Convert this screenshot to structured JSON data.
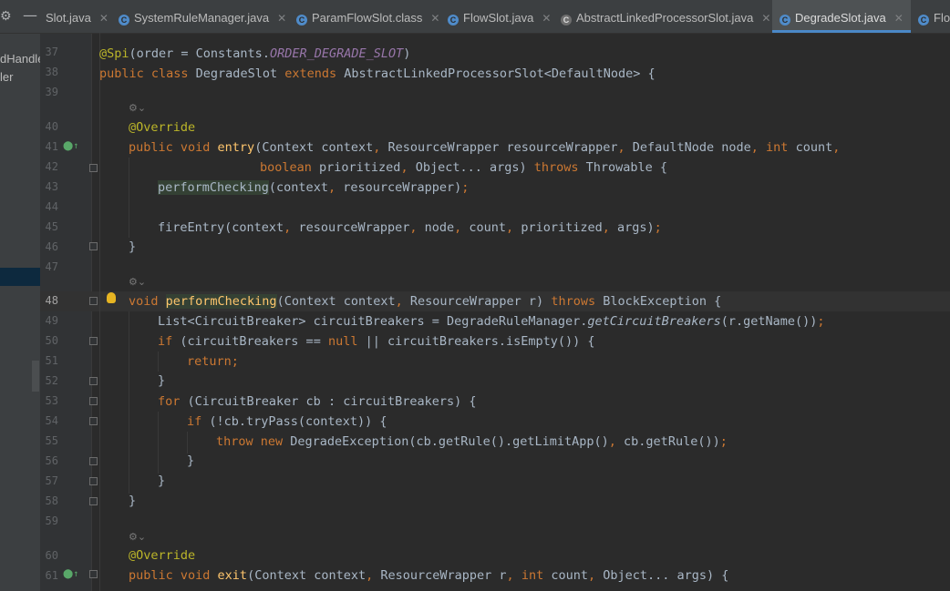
{
  "tabs": [
    {
      "label": "Slot.java",
      "icon": "",
      "active": false
    },
    {
      "label": "SystemRuleManager.java",
      "icon": "class-icon",
      "active": false
    },
    {
      "label": "ParamFlowSlot.class",
      "icon": "class-icon",
      "active": false
    },
    {
      "label": "FlowSlot.java",
      "icon": "class-icon",
      "active": false
    },
    {
      "label": "AbstractLinkedProcessorSlot.java",
      "icon": "abstract-class-icon",
      "active": false
    },
    {
      "label": "DegradeSlot.java",
      "icon": "class-icon",
      "active": true
    },
    {
      "label": "Flo",
      "icon": "class-icon",
      "active": false
    }
  ],
  "left_panel": {
    "items": [
      "dHandle",
      "ler"
    ]
  },
  "line_numbers": [
    "37",
    "38",
    "39",
    "40",
    "41",
    "42",
    "43",
    "44",
    "45",
    "46",
    "47",
    "48",
    "49",
    "50",
    "51",
    "52",
    "53",
    "54",
    "55",
    "56",
    "57",
    "58",
    "59",
    "60",
    "61"
  ],
  "code": {
    "l37_a": "@Spi",
    "l37_b": "(order = Constants.",
    "l37_c": "ORDER_DEGRADE_SLOT",
    "l37_d": ")",
    "l38_a": "public class ",
    "l38_b": "DegradeSlot ",
    "l38_c": "extends ",
    "l38_d": "AbstractLinkedProcessorSlot<DefaultNode> {",
    "l40": "@Override",
    "l41_a": "public void ",
    "l41_b": "entry",
    "l41_c": "(Context context",
    "l41_d": ", ",
    "l41_e": "ResourceWrapper resourceWrapper",
    "l41_f": ", ",
    "l41_g": "DefaultNode node",
    "l41_h": ", ",
    "l41_i": "int ",
    "l41_j": "count",
    "l41_k": ",",
    "l42_a": "boolean ",
    "l42_b": "prioritized",
    "l42_c": ", ",
    "l42_d": "Object... args) ",
    "l42_e": "throws ",
    "l42_f": "Throwable {",
    "l43_a": "performChecking",
    "l43_b": "(context",
    "l43_c": ", ",
    "l43_d": "resourceWrapper)",
    "l43_e": ";",
    "l45_a": "fireEntry(context",
    "l45_b": ", ",
    "l45_c": "resourceWrapper",
    "l45_d": ", ",
    "l45_e": "node",
    "l45_f": ", ",
    "l45_g": "count",
    "l45_h": ", ",
    "l45_i": "prioritized",
    "l45_j": ", ",
    "l45_k": "args)",
    "l45_l": ";",
    "l46": "}",
    "l48_a": "void ",
    "l48_b": "performChecking",
    "l48_c": "(Context context",
    "l48_d": ", ",
    "l48_e": "ResourceWrapper r) ",
    "l48_f": "throws ",
    "l48_g": "BlockException {",
    "l49_a": "List<CircuitBreaker> circuitBreakers = DegradeRuleManager.",
    "l49_b": "getCircuitBreakers",
    "l49_c": "(r.getName())",
    "l49_d": ";",
    "l50_a": "if ",
    "l50_b": "(circuitBreakers == ",
    "l50_c": "null ",
    "l50_d": "|| circuitBreakers.isEmpty()) {",
    "l51": "return;",
    "l52": "}",
    "l53_a": "for ",
    "l53_b": "(CircuitBreaker cb : circuitBreakers) {",
    "l54_a": "if ",
    "l54_b": "(!cb.tryPass(context)) {",
    "l55_a": "throw new ",
    "l55_b": "DegradeException(cb.getRule().getLimitApp()",
    "l55_c": ", ",
    "l55_d": "cb.getRule())",
    "l55_e": ";",
    "l56": "}",
    "l57": "}",
    "l58": "}",
    "l60": "@Override",
    "l61_a": "public void ",
    "l61_b": "exit",
    "l61_c": "(Context context",
    "l61_d": ", ",
    "l61_e": "ResourceWrapper r",
    "l61_f": ", ",
    "l61_g": "int ",
    "l61_h": "count",
    "l61_i": ", ",
    "l61_j": "Object... args) {"
  },
  "colors": {
    "background": "#2b2b2b",
    "keyword": "#cc7832",
    "annotation": "#bbb529",
    "method": "#ffc66d",
    "constant": "#9876aa",
    "text": "#a9b7c6",
    "tab_accent": "#4a88c7"
  }
}
